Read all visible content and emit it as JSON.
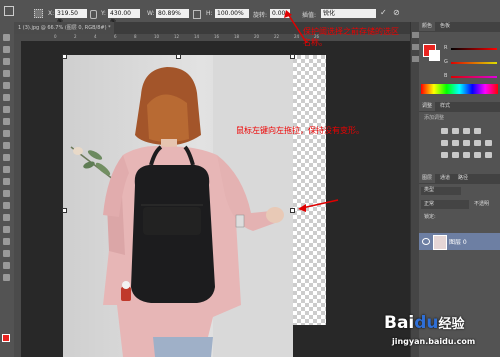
{
  "options_bar": {
    "x_label": "X:",
    "x_value": "319.50 像",
    "y_label": "Y:",
    "y_value": "430.00 像",
    "w_label": "W:",
    "w_value": "80.89%",
    "h_label": "H:",
    "h_value": "100.00%",
    "rotate_label": "旋转:",
    "rotate_value": "0.00",
    "interp_label": "插值:",
    "interp_value": "锐化",
    "confirm": "✓",
    "cancel": "⊘"
  },
  "document_tab": {
    "label": "1 (3).jpg @ 66.7% (图层 0, RGB/8#) *",
    "close": "×"
  },
  "ruler_numbers": [
    "0",
    "2",
    "4",
    "6",
    "8",
    "10",
    "12",
    "14",
    "16",
    "18",
    "20",
    "22",
    "24",
    "26"
  ],
  "annotations": {
    "top_note": "保护阈选择之前存储的选区名称。",
    "middle_note": "鼠标左键向左拖拉，保持没有变形。"
  },
  "panels": {
    "color_tab": "颜色",
    "swatches_tab": "色板",
    "channel_labels": [
      "R",
      "G",
      "B"
    ],
    "adjustments_tab": "调整",
    "styles_tab": "样式",
    "adjustments_hint": "添加调整",
    "layers_tab": "图层",
    "channels_tab": "通道",
    "paths_tab": "路径",
    "kind_label": "类型",
    "blend_mode": "正常",
    "opacity_label": "不透明",
    "lock_label": "锁定:",
    "layer_name": "图层 0"
  },
  "watermark": {
    "brand": "Bai",
    "brand2": "经验",
    "url": "jingyan.baidu.com"
  },
  "colors": {
    "foreground": "#e8231f",
    "background": "#ffffff",
    "accent_arrow": "#e00000"
  }
}
